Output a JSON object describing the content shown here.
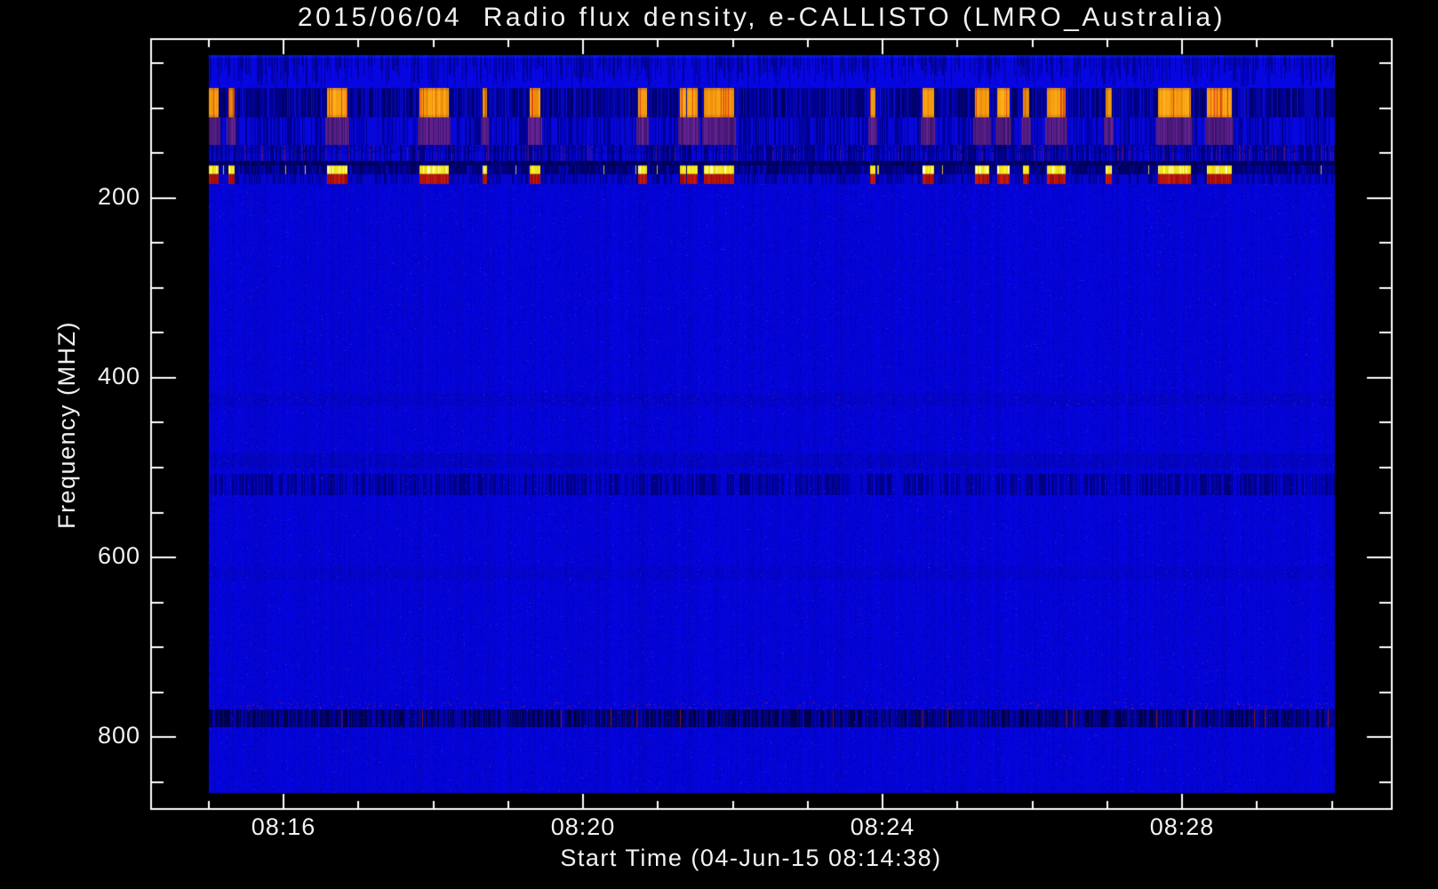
{
  "page": {
    "background_color": "#000000",
    "text_color": "#f2f2f2"
  },
  "chart_data": {
    "type": "heatmap",
    "title": "2015/06/04  Radio flux density, e-CALLISTO (LMRO_Australia)",
    "xlabel": "Start Time (04-Jun-15 08:14:38)",
    "ylabel": "Frequency (MHZ)",
    "x_tick_labels": [
      "08:16",
      "08:20",
      "08:24",
      "08:28"
    ],
    "x_major_minutes": [
      16,
      20,
      24,
      28
    ],
    "x_minor_step_min": 1,
    "x_range_minutes": [
      14.23,
      30.8
    ],
    "y_tick_labels": [
      "200",
      "400",
      "600",
      "800"
    ],
    "y_tick_values": [
      200,
      400,
      600,
      800
    ],
    "y_minor_step_mhz": 50,
    "y_range_mhz": [
      23,
      880
    ],
    "y_axis_inverted": true,
    "grid": false,
    "legend": false,
    "image_time_minutes": [
      15.0,
      30.04
    ],
    "image_freq_mhz": [
      41,
      862
    ],
    "colors": {
      "background": "#000000",
      "frame": "#ffffff",
      "quiet_blue": "#0606d4",
      "dark_navy": "#000078",
      "burst_orange": "#ff8c14",
      "burst_red_streak": "#d23c1e",
      "burst_yellow_line": "#fff23c",
      "burst_dark_red_line": "#a00808",
      "burst_purple_shadow": "#5a1e96"
    },
    "bands": [
      {
        "id": "comb",
        "f_mhz": [
          41,
          77
        ],
        "desc": "textured blue noise band with dark vertical streaks"
      },
      {
        "id": "bursts",
        "f_mhz": [
          77,
          110
        ],
        "desc": "strong intermittent RFI bursts (orange blocks on dark navy)"
      },
      {
        "id": "purple",
        "f_mhz": [
          110,
          141
        ],
        "desc": "purple shadow columns under each burst"
      },
      {
        "id": "barcode",
        "f_mhz": [
          141,
          159
        ],
        "desc": "striped interference texture"
      },
      {
        "id": "darkline",
        "f_mhz": [
          159,
          164
        ],
        "desc": "dark horizontal line"
      },
      {
        "id": "yellow",
        "f_mhz": [
          164,
          173
        ],
        "desc": "bright yellow dashed RFI line under bursts"
      },
      {
        "id": "reddash",
        "f_mhz": [
          173,
          184
        ],
        "desc": "dark red dashed RFI line under bursts"
      },
      {
        "id": "faint1",
        "f_mhz": [
          417,
          432
        ],
        "desc": "very faint darker band with rare magenta speckles"
      },
      {
        "id": "midtex",
        "f_mhz": [
          484,
          501
        ],
        "desc": "faint dark textured band"
      },
      {
        "id": "midbar",
        "f_mhz": [
          507,
          531
        ],
        "desc": "dark navy barcode band"
      },
      {
        "id": "faint2",
        "f_mhz": [
          610,
          625
        ],
        "desc": "very faint darker band"
      },
      {
        "id": "speckle",
        "f_mhz": [
          761,
          769
        ],
        "desc": "sparse red/purple speckle row"
      },
      {
        "id": "lowbar",
        "f_mhz": [
          769,
          789
        ],
        "desc": "dark navy barcode band with rare red pixels"
      }
    ],
    "rfi_bursts": [
      {
        "x0": 0.0,
        "x1": 0.008,
        "i": 0.8
      },
      {
        "x0": 0.017,
        "x1": 0.022,
        "i": 0.7
      },
      {
        "x0": 0.105,
        "x1": 0.122,
        "i": 1.0
      },
      {
        "x0": 0.187,
        "x1": 0.212,
        "i": 1.0
      },
      {
        "x0": 0.243,
        "x1": 0.246,
        "i": 0.7
      },
      {
        "x0": 0.285,
        "x1": 0.294,
        "i": 0.8
      },
      {
        "x0": 0.381,
        "x1": 0.388,
        "i": 0.8
      },
      {
        "x0": 0.418,
        "x1": 0.423,
        "i": 0.8
      },
      {
        "x0": 0.425,
        "x1": 0.433,
        "i": 0.8
      },
      {
        "x0": 0.44,
        "x1": 0.466,
        "i": 1.0
      },
      {
        "x0": 0.587,
        "x1": 0.591,
        "i": 0.7
      },
      {
        "x0": 0.634,
        "x1": 0.643,
        "i": 0.8
      },
      {
        "x0": 0.68,
        "x1": 0.692,
        "i": 1.0
      },
      {
        "x0": 0.7,
        "x1": 0.71,
        "i": 0.8
      },
      {
        "x0": 0.723,
        "x1": 0.728,
        "i": 0.7
      },
      {
        "x0": 0.744,
        "x1": 0.76,
        "i": 1.0
      },
      {
        "x0": 0.796,
        "x1": 0.801,
        "i": 0.7
      },
      {
        "x0": 0.843,
        "x1": 0.871,
        "i": 1.0
      },
      {
        "x0": 0.886,
        "x1": 0.908,
        "i": 1.0
      }
    ]
  }
}
